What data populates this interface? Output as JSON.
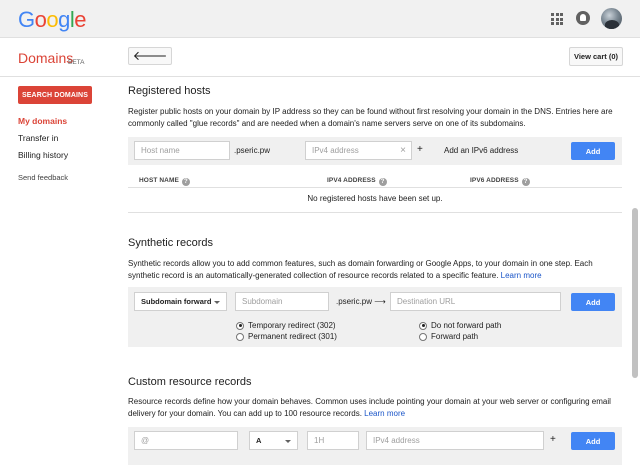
{
  "topbar": {
    "logo_letters": [
      {
        "ch": "G",
        "color": "#4285f4"
      },
      {
        "ch": "o",
        "color": "#ea4335"
      },
      {
        "ch": "o",
        "color": "#fbbc05"
      },
      {
        "ch": "g",
        "color": "#4285f4"
      },
      {
        "ch": "l",
        "color": "#34a853"
      },
      {
        "ch": "e",
        "color": "#ea4335"
      }
    ],
    "apps_icon": "apps-grid-icon",
    "notifications_icon": "bell-icon",
    "avatar_icon": "user-avatar"
  },
  "header": {
    "brand": "Domains",
    "beta": "BETA",
    "back_glyph": "🡐",
    "view_cart": "View cart (0)"
  },
  "sidebar": {
    "search_button": "SEARCH DOMAINS",
    "items": [
      {
        "label": "My domains",
        "active": true
      },
      {
        "label": "Transfer in",
        "active": false
      },
      {
        "label": "Billing history",
        "active": false
      }
    ],
    "send_feedback": "Send feedback"
  },
  "registered_hosts": {
    "title": "Registered hosts",
    "description": "Register public hosts on your domain by IP address so they can be found without first resolving your domain in the DNS. Entries here are commonly called \"glue records\" and are needed when a domain's name servers serve on one of its subdomains.",
    "host_name_placeholder": "Host name",
    "domain_suffix": ".pseric.pw",
    "ipv4_placeholder": "IPv4 address",
    "clear_glyph": "×",
    "plus": "+",
    "add_ipv6_link": "Add an IPv6 address",
    "add_button": "Add",
    "columns": [
      "HOST NAME",
      "IPV4 ADDRESS",
      "IPV6 ADDRESS"
    ],
    "help_glyph": "?",
    "empty_message": "No registered hosts have been set up."
  },
  "synthetic_records": {
    "title": "Synthetic records",
    "description": "Synthetic records allow you to add common features, such as domain forwarding or Google Apps, to your domain in one step. Each synthetic record is an automatically-generated collection of resource records related to a specific feature.",
    "learn_more": "Learn more",
    "type_select": "Subdomain forward",
    "subdomain_placeholder": "Subdomain",
    "domain_suffix": ".pseric.pw",
    "arrow": "⟶",
    "destination_placeholder": "Destination URL",
    "add_button": "Add",
    "redirect_options": [
      {
        "label": "Temporary redirect (302)",
        "selected": true
      },
      {
        "label": "Permanent redirect (301)",
        "selected": false
      }
    ],
    "path_options": [
      {
        "label": "Do not forward path",
        "selected": true
      },
      {
        "label": "Forward path",
        "selected": false
      }
    ]
  },
  "custom_records": {
    "title": "Custom resource records",
    "description": "Resource records define how your domain behaves. Common uses include pointing your domain at your web server or configuring email delivery for your domain. You can add up to 100 resource records.",
    "learn_more": "Learn more",
    "name_placeholder": "@",
    "type_select": "A",
    "ttl_placeholder": "1H",
    "data_placeholder": "IPv4 address",
    "plus": "+",
    "add_button": "Add"
  }
}
